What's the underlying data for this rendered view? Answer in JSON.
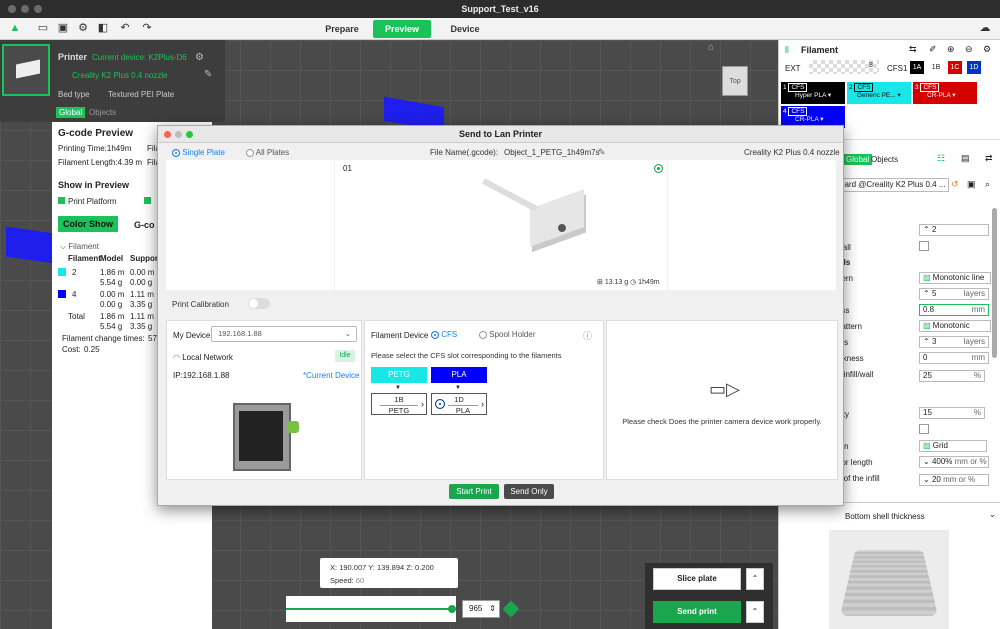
{
  "window": {
    "title": "Support_Test_v16"
  },
  "tabs": {
    "prepare": "Prepare",
    "preview": "Preview",
    "device": "Device"
  },
  "printer_panel": {
    "label": "Printer",
    "current_device": "Current device: K2Plus-D6",
    "nozzle": "Creality K2 Plus 0.4 nozzle",
    "bed_type_label": "Bed type",
    "bed_type_value": "Textured PEI Plate",
    "tab_global": "Global",
    "tab_objects": "Objects"
  },
  "gcode_preview": {
    "title": "G-code Preview",
    "printing_time": "Printing Time:1h49m",
    "filament_length": "Filament Length:4.39 m",
    "fila1": "Fila",
    "fila2": "Fila",
    "show_in_preview": "Show in Preview",
    "print_platform": "Print Platform",
    "color_show": "Color Show",
    "gcode_short": "G-co",
    "filament_group": "Filament",
    "col_filament": "Filament",
    "col_model": "Model",
    "col_support": "Suppor",
    "row1_id": "2",
    "row1_model_m": "1.86 m",
    "row1_model_g": "5.54 g",
    "row1_sup_m": "0.00 m",
    "row1_sup_g": "0.00 g",
    "row2_id": "4",
    "row2_model_m": "0.00 m",
    "row2_model_g": "0.00 g",
    "row2_sup_m": "1.11 m",
    "row2_sup_g": "3.35 g",
    "total_label": "Total",
    "total_model_m": "1.86 m",
    "total_model_g": "5.54 g",
    "total_sup_m": "1.11 m",
    "total_sup_g": "3.35 g",
    "change_times": "Filament change times:",
    "change_times_val": "57",
    "cost": "Cost:",
    "cost_val": "0.25",
    "colors": {
      "row1": "#19e6e6",
      "row2": "#0000ff"
    }
  },
  "filament_panel": {
    "title": "Filament",
    "ext": "EXT",
    "ext_num": "8",
    "cfs1": "CFS1",
    "slot_1a": "1A",
    "slot_1b": "1B",
    "slot_1c": "1C",
    "slot_1d": "1D",
    "f1_num": "1",
    "f1_cfs": "CFS",
    "f1_name": "Hyper PLA",
    "f2_num": "2",
    "f2_cfs": "CFS",
    "f2_name": "Generic PE...",
    "f3_num": "3",
    "f3_cfs": "CFS",
    "f3_name": "CR-PLA",
    "f4_num": "4",
    "f4_cfs": "CFS",
    "f4_name": "CR-PLA",
    "colors": {
      "f1": "#000000",
      "f2": "#19e6e6",
      "f3": "#d40000",
      "f4": "#0000ff"
    }
  },
  "settings_panel": {
    "tab_global": "Global",
    "tab_objects": "Objects",
    "preset": "dard @Creality K2 Plus 0.4 ...",
    "val_2": "2",
    "wall": "wall",
    "ells": "ells",
    "tern": "ttern",
    "pattern_val": "Monotonic line",
    "ess": "ess",
    "layers_val_5": "5",
    "layers_unit": "layers",
    "mm_val_08": "0.8",
    "mm_unit": "mm",
    "pattern2": "pattern",
    "pattern2_val": "Monotonic",
    "ers": "ers",
    "layers_val_3": "3",
    "ckness": "ickness",
    "thick_val": "0",
    "infill_wall": "d infill/wall",
    "infill_wall_val": "25",
    "pct": "%",
    "sity": "sity",
    "sity_val": "15",
    "ern": "ern",
    "grid_val": "Grid",
    "anchor": "hor length",
    "anchor_val": "400%",
    "anchor_unit": "mm or %",
    "infill_of": "h of the infill",
    "infill_of_val": "20",
    "bottom_shell": "Bottom shell thickness"
  },
  "dialog": {
    "title": "Send to Lan Printer",
    "single_plate": "Single Plate",
    "all_plates": "All Plates",
    "file_name_label": "File Name(.gcode):",
    "file_name": "Object_1_PETG_1h49m7s",
    "printer_name": "Creality K2 Plus 0.4 nozzle",
    "plate_number": "01",
    "plate_stats": "13.13 g",
    "plate_time": "1h49m",
    "print_calibration": "Print Calibration",
    "my_device_label": "My Device",
    "my_device_value": "192.168.1.88",
    "local_network": "Local Network",
    "idle": "Idle",
    "ip": "IP:192.168.1.88",
    "current_device": "*Current Device",
    "filament_device": "Filament Device",
    "cfs": "CFS",
    "spool_holder": "Spool Holder",
    "select_slot_msg": "Please select the CFS slot corresponding to the filaments",
    "fil1_name": "PETG",
    "fil2_name": "PLA",
    "slot1_id": "1B",
    "slot1_name": "PETG",
    "slot2_id": "1D",
    "slot2_name": "PLA",
    "camera_msg": "Please check Does the printer camera device work properly.",
    "start_print": "Start Print",
    "send_only": "Send Only",
    "colors": {
      "fil1": "#19e6e6",
      "fil2": "#0000ff"
    }
  },
  "viewport": {
    "top_label": "Top",
    "coord_x_label": "X:",
    "coord_x": "190.007",
    "coord_y_label": "Y:",
    "coord_y": "139.894",
    "coord_z_label": "Z:",
    "coord_z": "0.200",
    "speed_label": "Speed:",
    "speed": "60",
    "layer_value": "965",
    "slice_plate": "Slice plate",
    "send_print": "Send print"
  }
}
